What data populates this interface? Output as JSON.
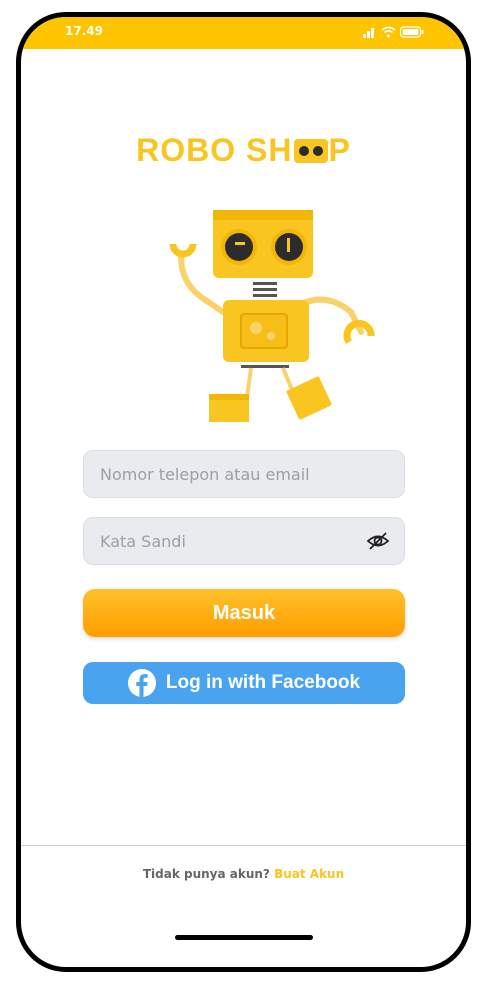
{
  "status_bar": {
    "time": "17.49"
  },
  "brand": {
    "title_left": "ROBO SH",
    "title_right": "P"
  },
  "login_form": {
    "email_placeholder": "Nomor telepon atau email",
    "password_placeholder": "Kata Sandi",
    "submit_label": "Masuk",
    "facebook_label": "Log in with Facebook"
  },
  "footer": {
    "prompt": "Tidak punya akun?",
    "signup_label": "Buat Akun"
  },
  "colors": {
    "status_bar": "#FFC400",
    "brand_yellow": "#F9C520",
    "button_orange": "#FF9E00",
    "facebook_blue": "#4AA3EE"
  },
  "icons": [
    "signal-icon",
    "wifi-icon",
    "battery-icon",
    "eye-off-icon",
    "facebook-icon"
  ]
}
